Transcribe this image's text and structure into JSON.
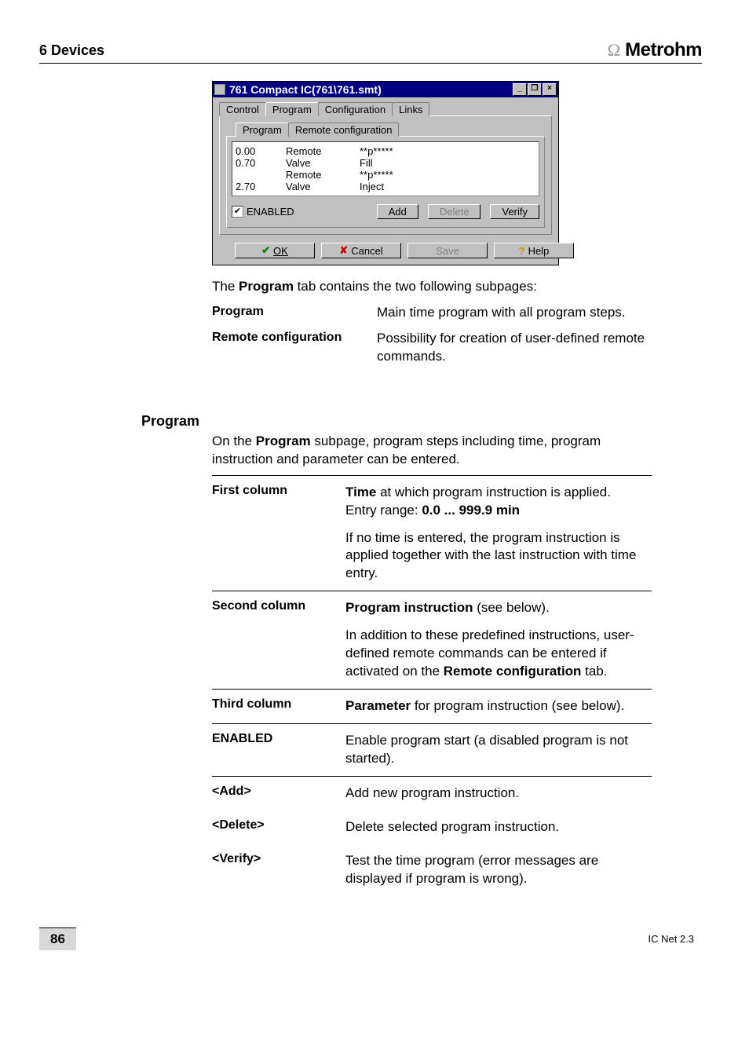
{
  "header": {
    "section": "6  Devices",
    "brand": "Metrohm"
  },
  "window": {
    "title": "761 Compact IC(761\\761.smt)",
    "minimize": "_",
    "restore": "❐",
    "close": "×",
    "outer_tabs": [
      "Control",
      "Program",
      "Configuration",
      "Links"
    ],
    "outer_active": "Program",
    "inner_tabs": [
      "Program",
      "Remote configuration"
    ],
    "inner_active": "Program",
    "program_rows": [
      {
        "t": "0.00",
        "cmd": "Remote",
        "param": "**p*****"
      },
      {
        "t": "0.70",
        "cmd": "Valve",
        "param": "Fill"
      },
      {
        "t": "",
        "cmd": "Remote",
        "param": "**p*****"
      },
      {
        "t": "2.70",
        "cmd": "Valve",
        "param": "Inject"
      }
    ],
    "enabled_checked": "✔",
    "enabled_label": "ENABLED",
    "btn_add": "Add",
    "btn_delete": "Delete",
    "btn_verify": "Verify",
    "btn_ok": "OK",
    "btn_cancel": "Cancel",
    "btn_save": "Save",
    "btn_help": "Help"
  },
  "text": {
    "intro": "The ",
    "intro_bold": "Program",
    "intro_rest": " tab contains the two following subpages:",
    "program_term": "Program",
    "program_desc": "Main time program with all program steps.",
    "remote_term": "Remote configuration",
    "remote_desc": "Possibility for creation of user-defined remote commands.",
    "program_heading": "Program",
    "program_para_a": "On the ",
    "program_para_bold": "Program",
    "program_para_b": " subpage, program steps including time, program instruction and parameter can be entered.",
    "rows": {
      "first_label": "First column",
      "first_b": "Time",
      "first_a": " at which program instruction is applied.",
      "first_range_a": "Entry range: ",
      "first_range_b": "0.0 ... 999.9 min",
      "first_note": "If no time is entered, the program instruction is applied together with the last instruction with time entry.",
      "second_label": "Second column",
      "second_b": "Program instruction",
      "second_a": " (see below).",
      "second_note_a": "In addition to these predefined instructions, user-defined remote commands can be entered if activated on the ",
      "second_note_b": "Remote configuration",
      "second_note_c": " tab.",
      "third_label": "Third column",
      "third_b": "Parameter",
      "third_a": " for program instruction (see below).",
      "enabled_label": "ENABLED",
      "enabled_desc": "Enable program start (a disabled program is not started).",
      "add_label": "<Add>",
      "add_desc": "Add new program instruction.",
      "delete_label": "<Delete>",
      "delete_desc": "Delete selected program instruction.",
      "verify_label": "<Verify>",
      "verify_desc": "Test the time program (error messages are displayed if program is wrong)."
    }
  },
  "footer": {
    "page": "86",
    "doc": "IC Net 2.3"
  }
}
